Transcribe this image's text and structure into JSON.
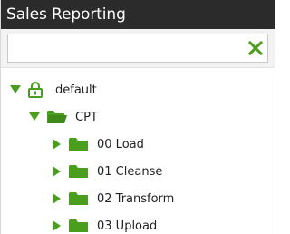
{
  "panel": {
    "title": "Sales Reporting"
  },
  "search": {
    "value": "",
    "placeholder": "",
    "clear_icon": "close-icon"
  },
  "tree": {
    "root": {
      "label": "default",
      "icon": "lock-icon",
      "expanded": true
    },
    "folder": {
      "label": "CPT",
      "icon": "folder-icon",
      "expanded": true
    },
    "children": [
      {
        "label": "00 Load",
        "icon": "folder-icon",
        "expanded": false
      },
      {
        "label": "01 Cleanse",
        "icon": "folder-icon",
        "expanded": false
      },
      {
        "label": "02 Transform",
        "icon": "folder-icon",
        "expanded": false
      },
      {
        "label": "03 Upload",
        "icon": "folder-icon",
        "expanded": false
      }
    ]
  },
  "colors": {
    "header_bg": "#2b2b2b",
    "accent_green": "#4a9e1e"
  }
}
